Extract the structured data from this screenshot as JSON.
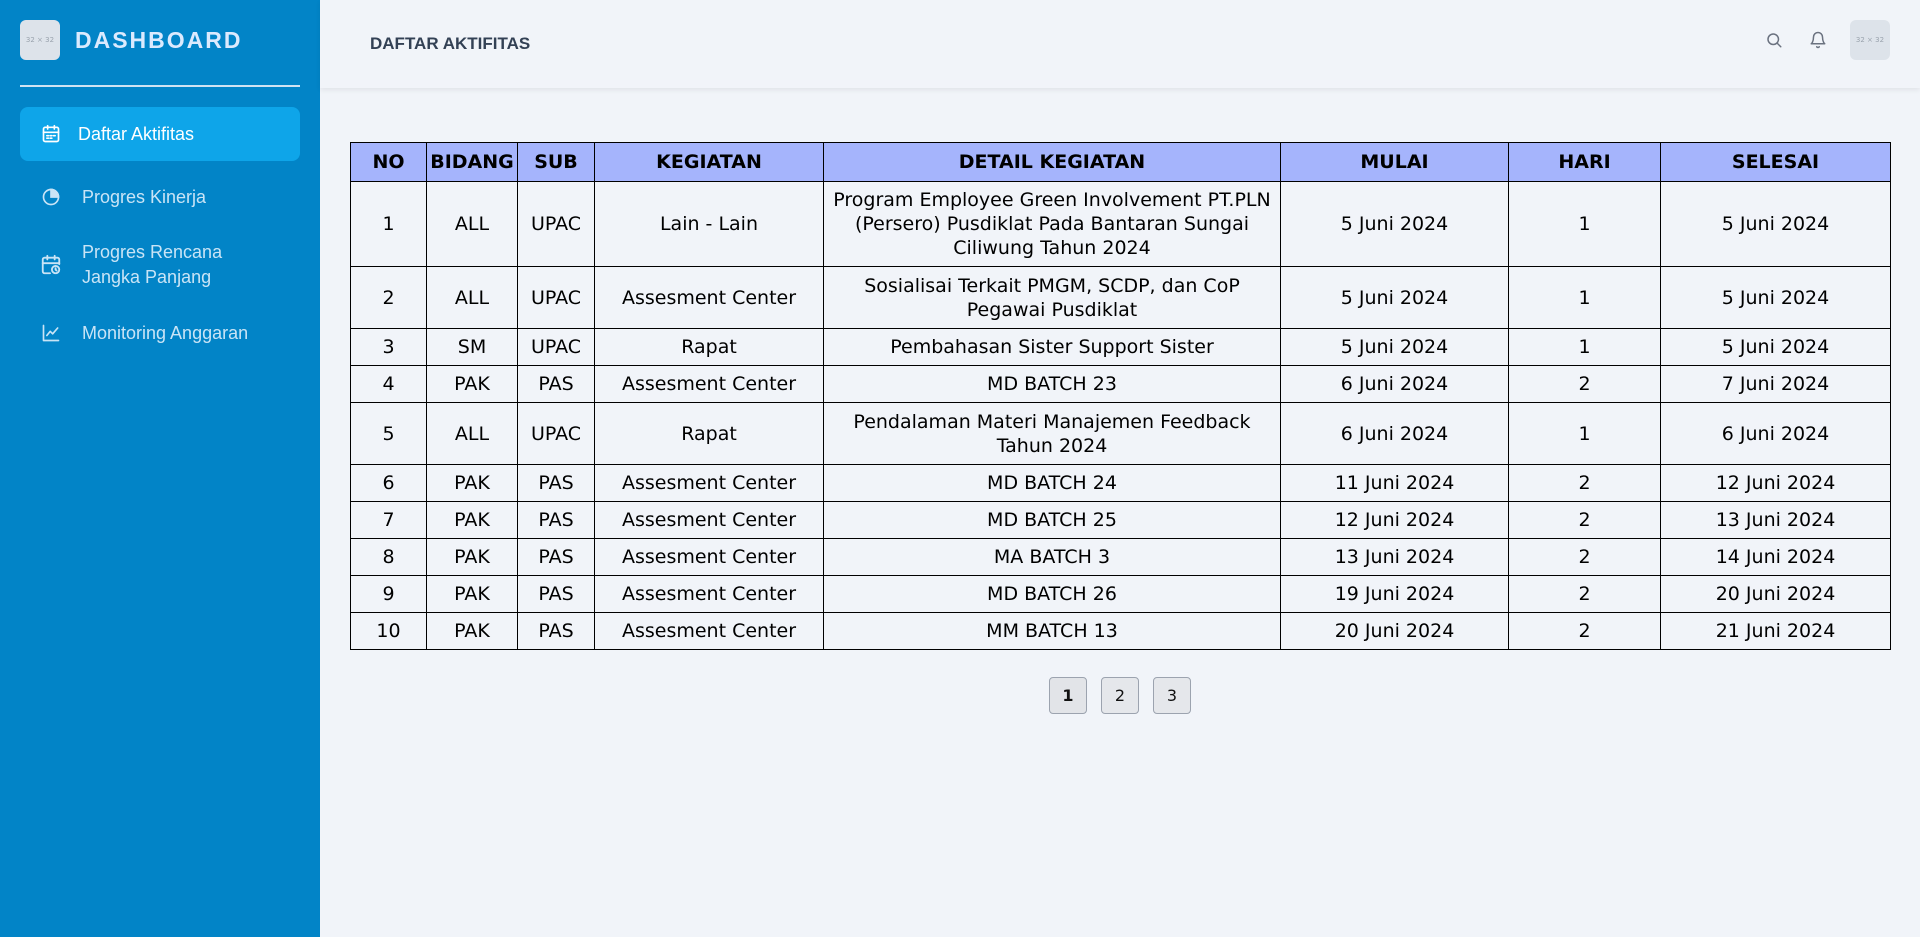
{
  "sidebar": {
    "logo_text": "32 × 32",
    "title": "DASHBOARD",
    "items": [
      {
        "label": "Daftar Aktifitas",
        "icon": "calendar-icon",
        "active": true
      },
      {
        "label": "Progres Kinerja",
        "icon": "pie-chart-icon",
        "active": false
      },
      {
        "label": "Progres Rencana Jangka Panjang",
        "icon": "calendar-clock-icon",
        "active": false
      },
      {
        "label": "Monitoring Anggaran",
        "icon": "line-chart-icon",
        "active": false
      }
    ]
  },
  "header": {
    "title": "DAFTAR AKTIFITAS",
    "avatar_text": "32 × 32"
  },
  "table": {
    "columns": [
      "NO",
      "BIDANG",
      "SUB",
      "KEGIATAN",
      "DETAIL KEGIATAN",
      "MULAI",
      "HARI",
      "SELESAI"
    ],
    "rows": [
      [
        "1",
        "ALL",
        "UPAC",
        "Lain - Lain",
        "Program Employee Green Involvement PT.PLN (Persero) Pusdiklat Pada Bantaran Sungai Ciliwung Tahun 2024",
        "5 Juni 2024",
        "1",
        "5 Juni 2024"
      ],
      [
        "2",
        "ALL",
        "UPAC",
        "Assesment Center",
        "Sosialisai Terkait PMGM, SCDP, dan CoP Pegawai Pusdiklat",
        "5 Juni 2024",
        "1",
        "5 Juni 2024"
      ],
      [
        "3",
        "SM",
        "UPAC",
        "Rapat",
        "Pembahasan Sister Support Sister",
        "5 Juni 2024",
        "1",
        "5 Juni 2024"
      ],
      [
        "4",
        "PAK",
        "PAS",
        "Assesment Center",
        "MD BATCH 23",
        "6 Juni 2024",
        "2",
        "7 Juni 2024"
      ],
      [
        "5",
        "ALL",
        "UPAC",
        "Rapat",
        "Pendalaman Materi Manajemen Feedback Tahun 2024",
        "6 Juni 2024",
        "1",
        "6 Juni 2024"
      ],
      [
        "6",
        "PAK",
        "PAS",
        "Assesment Center",
        "MD BATCH 24",
        "11 Juni 2024",
        "2",
        "12 Juni 2024"
      ],
      [
        "7",
        "PAK",
        "PAS",
        "Assesment Center",
        "MD BATCH 25",
        "12 Juni 2024",
        "2",
        "13 Juni 2024"
      ],
      [
        "8",
        "PAK",
        "PAS",
        "Assesment Center",
        "MA BATCH 3",
        "13 Juni 2024",
        "2",
        "14 Juni 2024"
      ],
      [
        "9",
        "PAK",
        "PAS",
        "Assesment Center",
        "MD BATCH 26",
        "19 Juni 2024",
        "2",
        "20 Juni 2024"
      ],
      [
        "10",
        "PAK",
        "PAS",
        "Assesment Center",
        "MM BATCH 13",
        "20 Juni 2024",
        "2",
        "21 Juni 2024"
      ]
    ]
  },
  "pagination": {
    "pages": [
      "1",
      "2",
      "3"
    ],
    "current": "1"
  },
  "colors": {
    "sidebar": "#0284c7",
    "active_item": "#0ea5e9",
    "table_header": "#a5b4fc",
    "background": "#f1f4f9"
  }
}
